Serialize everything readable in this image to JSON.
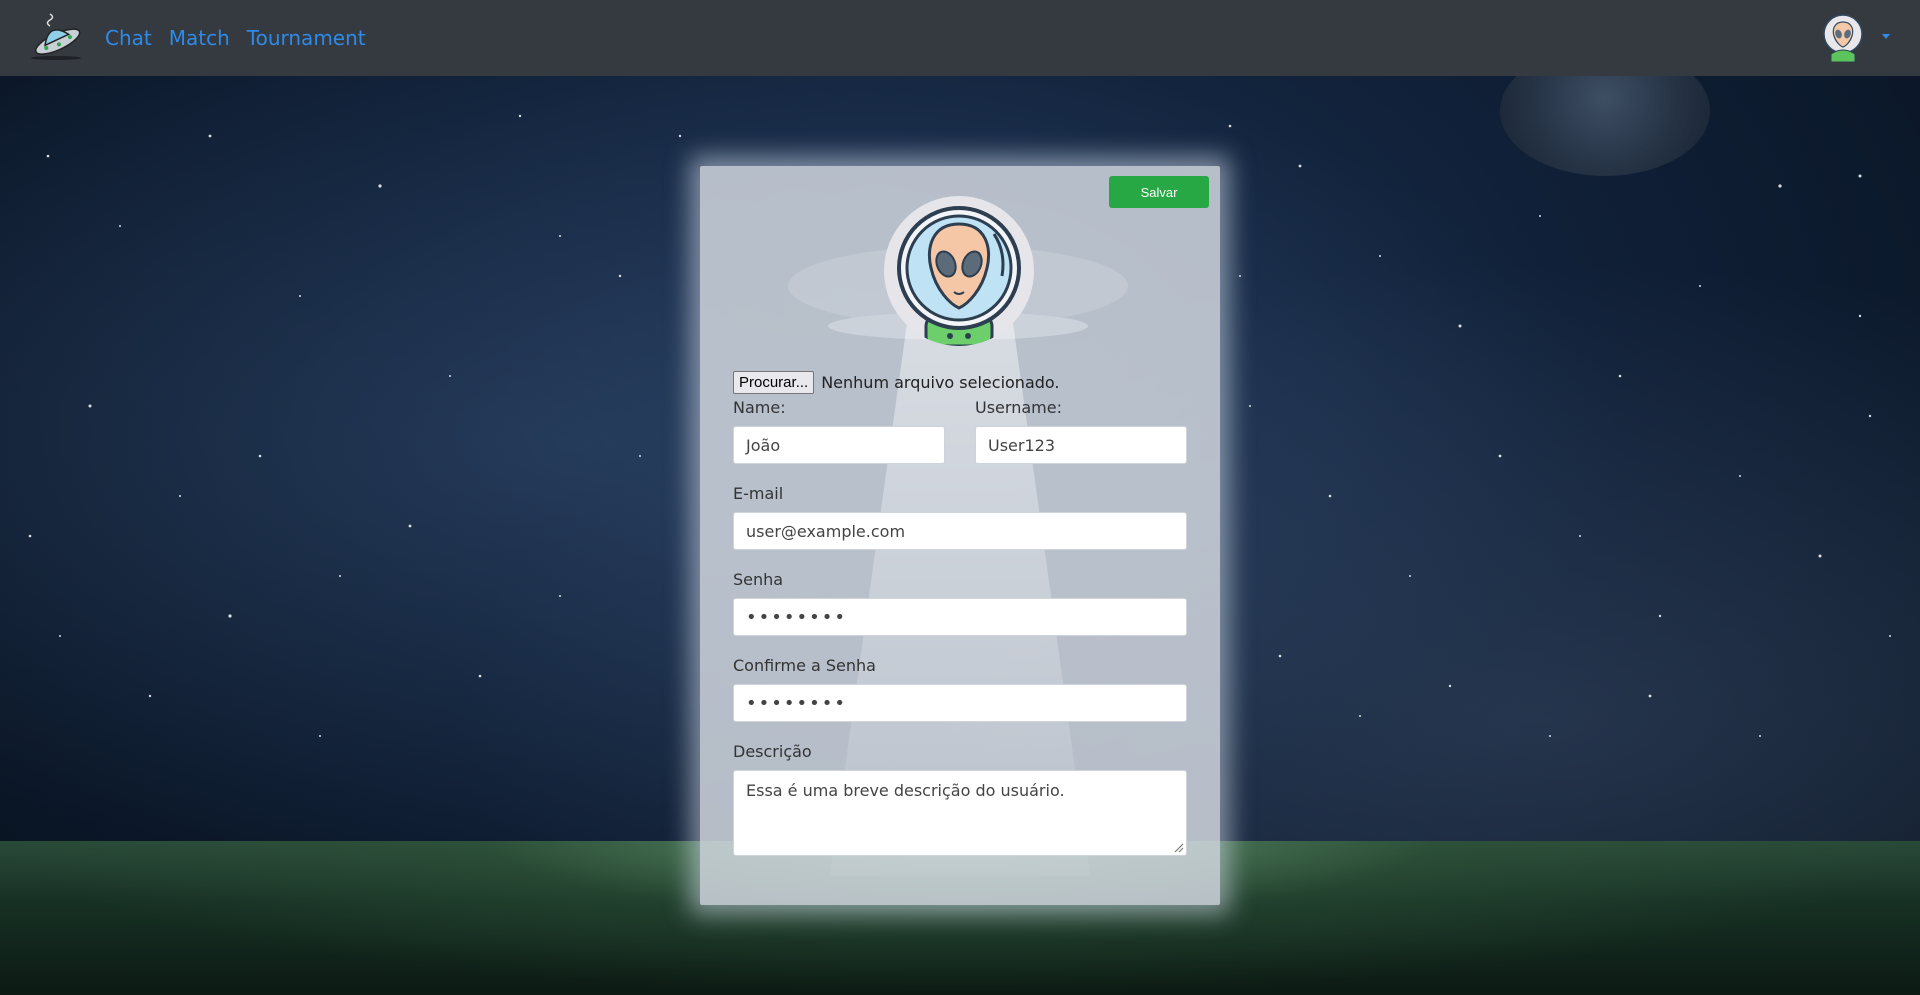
{
  "nav": {
    "links": [
      "Chat",
      "Match",
      "Tournament"
    ]
  },
  "form": {
    "save_label": "Salvar",
    "file_button": "Procurar...",
    "file_status": "Nenhum arquivo selecionado.",
    "name_label": "Name:",
    "name_value": "João",
    "username_label": "Username:",
    "username_value": "User123",
    "email_label": "E-mail",
    "email_value": "user@example.com",
    "password_label": "Senha",
    "password_value": "••••••••",
    "confirm_label": "Confirme a Senha",
    "confirm_value": "••••••••",
    "description_label": "Descrição",
    "description_value": "Essa é uma breve descrição do usuário."
  },
  "colors": {
    "navbar": "#343a40",
    "link": "#2f8ae8",
    "save_button": "#28a745"
  },
  "icons": {
    "brand": "ufo-logo-icon",
    "avatar": "alien-astronaut-icon",
    "dropdown": "caret-down-icon"
  }
}
